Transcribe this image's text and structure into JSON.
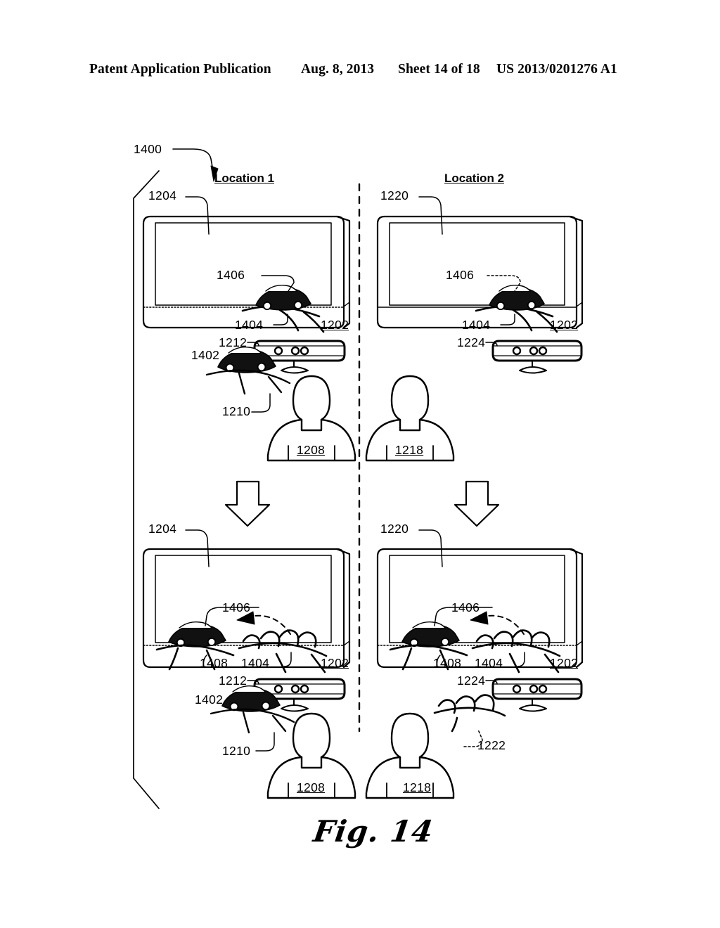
{
  "header": {
    "publication": "Patent Application Publication",
    "date": "Aug. 8, 2013",
    "sheet": "Sheet 14 of 18",
    "number": "US 2013/0201276 A1"
  },
  "figure": {
    "caption": "Fig. 14",
    "system_numeral": "1400"
  },
  "columns": [
    {
      "id": "location-1",
      "label": "Location 1"
    },
    {
      "id": "location-2",
      "label": "Location 2"
    }
  ],
  "panels": {
    "top_left": {
      "display_ref": "1204",
      "surface_ref": "1202",
      "virtual_object_ref": "1406",
      "displayed_hand_ref": "1404",
      "sensor_ref": "1212",
      "local_object_ref": "1402",
      "local_hand_ref": "1210",
      "person_ref": "1208"
    },
    "top_right": {
      "display_ref": "1220",
      "surface_ref": "1202",
      "virtual_object_ref": "1406",
      "displayed_hand_ref": "1404",
      "sensor_ref": "1224",
      "person_ref": "1218"
    },
    "bottom_left": {
      "display_ref": "1204",
      "surface_ref": "1202",
      "virtual_object_ref": "1406",
      "displayed_hand_ref": "1404",
      "received_object_ref": "1408",
      "sensor_ref": "1212",
      "local_object_ref": "1402",
      "local_hand_ref": "1210",
      "person_ref": "1208"
    },
    "bottom_right": {
      "display_ref": "1220",
      "surface_ref": "1202",
      "virtual_object_ref": "1406",
      "displayed_hand_ref": "1404",
      "received_object_ref": "1408",
      "sensor_ref": "1224",
      "person_ref": "1218",
      "local_hand_ref": "1222"
    }
  },
  "icons": {
    "transition_arrow": "down-block-arrow",
    "lead_arrow": "leader-arrow",
    "motion_arc": "dashed-motion-arc",
    "divider": "vertical-dashed-divider",
    "sensor": "depth-camera-sensor-bar",
    "person": "person-silhouette",
    "display": "flat-panel-display",
    "vehicle": "sports-car",
    "hand": "open-hand"
  },
  "colors": {
    "ink": "#000000",
    "paper": "#ffffff"
  }
}
